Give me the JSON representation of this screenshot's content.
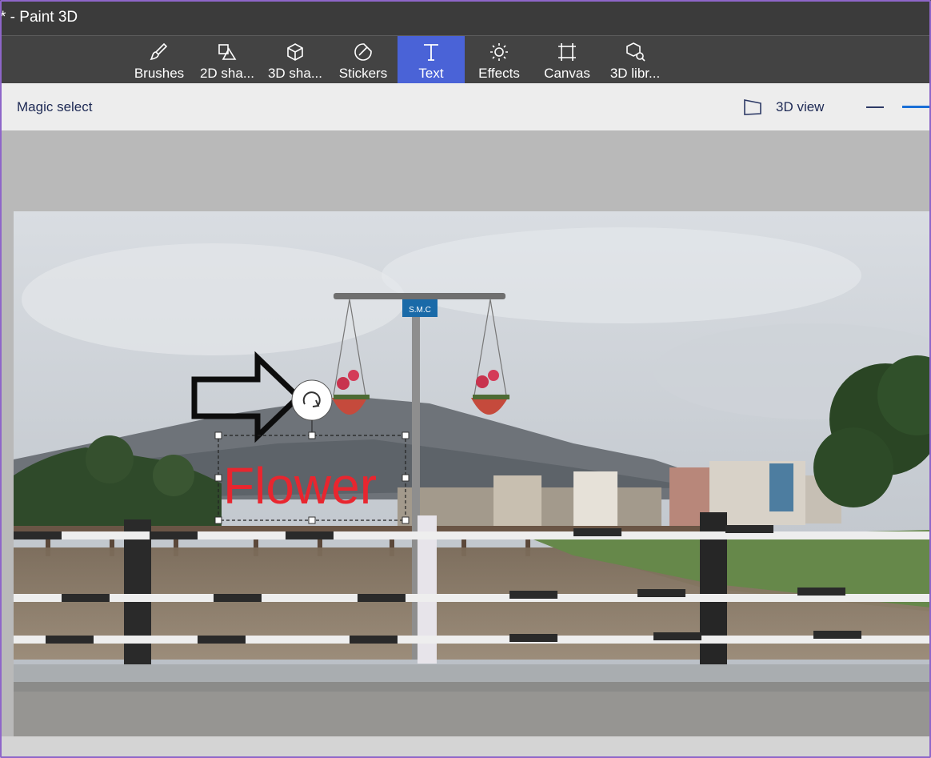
{
  "window": {
    "title": "* - Paint 3D"
  },
  "ribbon": {
    "tools": [
      {
        "label": "Brushes",
        "icon": "brush-icon",
        "active": false
      },
      {
        "label": "2D sha...",
        "icon": "2d-shapes-icon",
        "active": false
      },
      {
        "label": "3D sha...",
        "icon": "3d-shapes-icon",
        "active": false
      },
      {
        "label": "Stickers",
        "icon": "stickers-icon",
        "active": false
      },
      {
        "label": "Text",
        "icon": "text-icon",
        "active": true
      },
      {
        "label": "Effects",
        "icon": "effects-icon",
        "active": false
      },
      {
        "label": "Canvas",
        "icon": "canvas-icon",
        "active": false
      },
      {
        "label": "3D libr...",
        "icon": "3d-library-icon",
        "active": false
      }
    ],
    "accent": "#4a63d7"
  },
  "toolbar": {
    "magic_select_label": "Magic select",
    "view3d_label": "3D view"
  },
  "canvas": {
    "text_box": {
      "value": "Flower",
      "color": "#e8262f"
    },
    "sign_text": "S.M.C",
    "rotate_handle_icon": "rotate-icon",
    "arrow_sticker": "arrow-right-icon"
  }
}
